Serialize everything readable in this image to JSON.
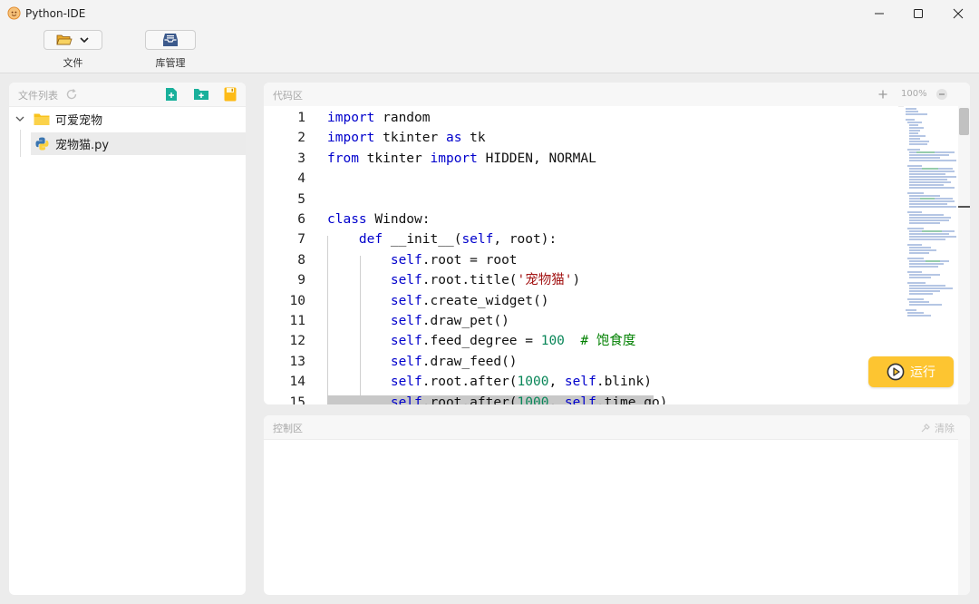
{
  "window": {
    "title": "Python-IDE"
  },
  "toolbar": {
    "file_label": "文件",
    "library_label": "库管理"
  },
  "file_panel": {
    "title": "文件列表",
    "folder_name": "可爱宠物",
    "file_name": "宠物猫.py"
  },
  "code_panel": {
    "title": "代码区",
    "zoom": "100%",
    "line_numbers": [
      "1",
      "2",
      "3",
      "4",
      "5",
      "6",
      "7",
      "8",
      "9",
      "10",
      "11",
      "12",
      "13",
      "14",
      "15"
    ],
    "run_label": "运行"
  },
  "console_panel": {
    "title": "控制区",
    "clear_label": "清除",
    "output": ""
  },
  "colors": {
    "accent": "#fdc531",
    "keyword": "#0000cc",
    "number": "#098658",
    "string": "#a31515",
    "comment": "#008000"
  }
}
